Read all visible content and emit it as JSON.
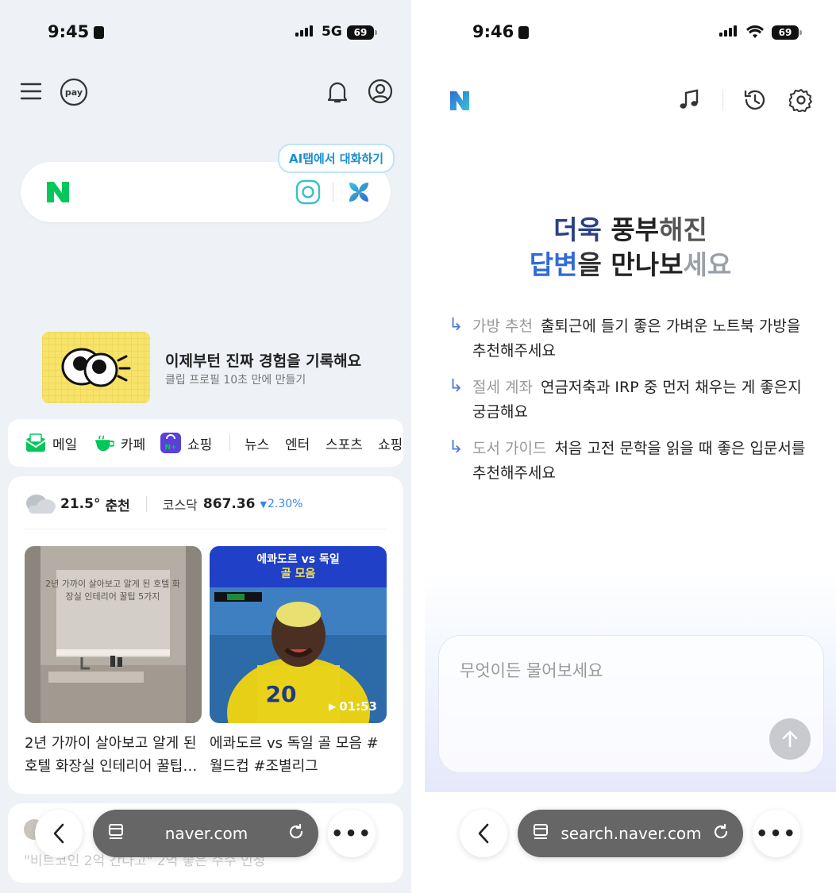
{
  "left": {
    "status": {
      "time": "9:45",
      "network": "5G",
      "battery": "69"
    },
    "tooltip": "AI탭에서 대화하기",
    "banner": {
      "title": "이제부턴 진짜 경험을 기록해요",
      "subtitle": "클립 프로필 10초 만에 만들기"
    },
    "services": [
      "메일",
      "카페",
      "쇼핑",
      "뉴스",
      "엔터",
      "스포츠",
      "쇼핑"
    ],
    "weather": {
      "temp": "21.5°",
      "city": "춘천"
    },
    "stock": {
      "name": "코스닥",
      "value": "867.36",
      "change": "2.30%"
    },
    "cards": [
      {
        "caption": "2년 가까이 살아보고 알게 된 호텔 화장실 인테리어 꿀팁…",
        "overlay": "2년 가까이 살아보고 알게 된 호텔 화장실 인테리어 꿀팁 5가지"
      },
      {
        "caption": "에콰도르 vs 독일 골 모음 #월드컵 #조별리그",
        "badge_line1": "에콰도르 vs 독일",
        "badge_line2": "골 모음",
        "duration": "01:53"
      }
    ],
    "peek_text": "\"비트코인 2억 간다고\" 2억 좋은 수수 인정",
    "nav": {
      "url": "naver.com",
      "more": "•••"
    }
  },
  "right": {
    "status": {
      "time": "9:46",
      "battery": "69"
    },
    "headline": {
      "l1a": "더욱 ",
      "l1b": "풍부",
      "l1c": "해진",
      "l2a": "답변",
      "l2b": "을 ",
      "l2c": "만나보",
      "l2d": "세요"
    },
    "suggestions": [
      {
        "tag": "가방 추천",
        "text": "출퇴근에 들기 좋은 가벼운 노트북 가방을 추천해주세요"
      },
      {
        "tag": "절세 계좌",
        "text": "연금저축과 IRP 중 먼저 채우는 게 좋은지 궁금해요"
      },
      {
        "tag": "도서 가이드",
        "text": "처음 고전 문학을 읽을 때 좋은 입문서를 추천해주세요"
      }
    ],
    "input_placeholder": "무엇이든 물어보세요",
    "nav": {
      "url": "search.naver.com",
      "more": "•••"
    }
  },
  "colors": {
    "naver_green": "#03c75a",
    "naver_blue": "#2f6bd6",
    "stock_down": "#3b82f6"
  }
}
